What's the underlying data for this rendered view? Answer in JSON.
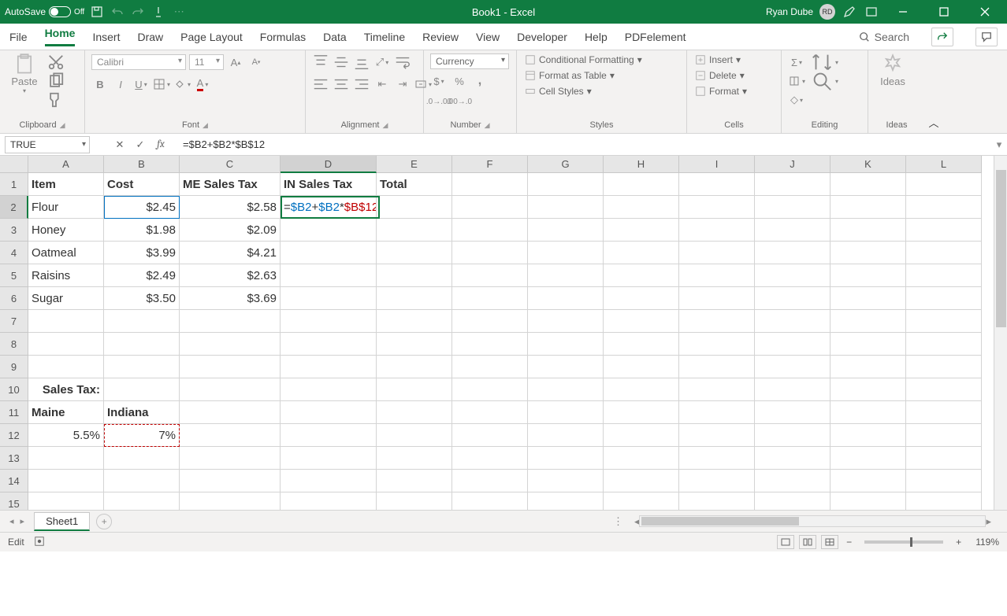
{
  "title": "Book1  -  Excel",
  "user": {
    "name": "Ryan Dube",
    "initials": "RD"
  },
  "autosave_label": "AutoSave",
  "autosave_state": "Off",
  "tabs": [
    "File",
    "Home",
    "Insert",
    "Draw",
    "Page Layout",
    "Formulas",
    "Data",
    "Timeline",
    "Review",
    "View",
    "Developer",
    "Help",
    "PDFelement"
  ],
  "active_tab": "Home",
  "search_label": "Search",
  "ribbon": {
    "clipboard": {
      "paste": "Paste",
      "label": "Clipboard"
    },
    "font": {
      "name": "Calibri",
      "size": "11",
      "label": "Font",
      "bold": "B",
      "italic": "I",
      "underline": "U"
    },
    "alignment": {
      "label": "Alignment"
    },
    "number": {
      "format": "Currency",
      "label": "Number",
      "dollar": "$",
      "pct": "%",
      "comma": ","
    },
    "styles": {
      "cond": "Conditional Formatting",
      "table": "Format as Table",
      "cell": "Cell Styles",
      "label": "Styles"
    },
    "cells": {
      "insert": "Insert",
      "delete": "Delete",
      "format": "Format",
      "label": "Cells"
    },
    "editing": {
      "label": "Editing"
    },
    "ideas": {
      "btn": "Ideas",
      "label": "Ideas"
    }
  },
  "name_box": "TRUE",
  "formula": "=$B2+$B2*$B$12",
  "formula_parts": {
    "eq": "=",
    "r1": "$B2",
    "plus": "+",
    "r2": "$B2",
    "mul": "*",
    "r3": "$B$12"
  },
  "columns": [
    "A",
    "B",
    "C",
    "D",
    "E",
    "F",
    "G",
    "H",
    "I",
    "J",
    "K",
    "L"
  ],
  "selected_col": "D",
  "selected_row": "2",
  "headers": {
    "A": "Item",
    "B": "Cost",
    "C": "ME Sales Tax",
    "D": "IN Sales Tax",
    "E": "Total"
  },
  "rows": [
    {
      "n": "1"
    },
    {
      "n": "2",
      "A": "Flour",
      "B": "$2.45",
      "C": "$2.58"
    },
    {
      "n": "3",
      "A": "Honey",
      "B": "$1.98",
      "C": "$2.09"
    },
    {
      "n": "4",
      "A": "Oatmeal",
      "B": "$3.99",
      "C": "$4.21"
    },
    {
      "n": "5",
      "A": "Raisins",
      "B": "$2.49",
      "C": "$2.63"
    },
    {
      "n": "6",
      "A": "Sugar",
      "B": "$3.50",
      "C": "$3.69"
    },
    {
      "n": "7"
    },
    {
      "n": "8"
    },
    {
      "n": "9"
    },
    {
      "n": "10",
      "A": "Sales Tax:"
    },
    {
      "n": "11",
      "A": "Maine",
      "B": "Indiana"
    },
    {
      "n": "12",
      "A": "5.5%",
      "B": "7%"
    },
    {
      "n": "13"
    },
    {
      "n": "14"
    },
    {
      "n": "15"
    }
  ],
  "sheet": "Sheet1",
  "status": "Edit",
  "zoom": "119%"
}
